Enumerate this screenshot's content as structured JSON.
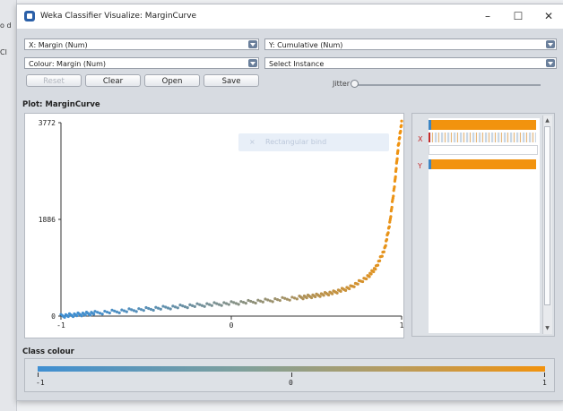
{
  "outer": {
    "labels": [
      "o d",
      "Cl"
    ]
  },
  "window": {
    "title": "Weka Classifier Visualize: MarginCurve",
    "minimize": "–",
    "maximize": "☐",
    "close": "✕"
  },
  "controls": {
    "x_axis": "X: Margin (Num)",
    "y_axis": "Y: Cumulative (Num)",
    "colour": "Colour: Margin (Num)",
    "select_instance": "Select Instance",
    "reset": "Reset",
    "clear": "Clear",
    "open": "Open",
    "save": "Save",
    "jitter": "Jitter"
  },
  "plot": {
    "label": "Plot: MarginCurve",
    "tooltip": "Rectangular bind",
    "tooltip_icon": "×"
  },
  "side": {
    "x_label": "X",
    "y_label": "Y"
  },
  "class_colour": {
    "label": "Class colour",
    "min": "-1",
    "mid": "0",
    "max": "1"
  },
  "colors": {
    "low": "#3f8fd2",
    "high": "#f2930e"
  },
  "chart_data": {
    "type": "scatter",
    "title": "",
    "xlabel": "",
    "ylabel": "",
    "xlim": [
      -1,
      1
    ],
    "ylim": [
      0,
      3772
    ],
    "x_ticks": [
      "-1",
      "0",
      "1"
    ],
    "y_ticks": [
      "0",
      "1886",
      "3772"
    ],
    "curve": [
      [
        -1.0,
        0
      ],
      [
        -0.9,
        30
      ],
      [
        -0.8,
        60
      ],
      [
        -0.6,
        110
      ],
      [
        -0.4,
        160
      ],
      [
        -0.2,
        210
      ],
      [
        0.0,
        250
      ],
      [
        0.2,
        300
      ],
      [
        0.4,
        360
      ],
      [
        0.5,
        400
      ],
      [
        0.6,
        460
      ],
      [
        0.7,
        560
      ],
      [
        0.8,
        760
      ],
      [
        0.85,
        950
      ],
      [
        0.9,
        1300
      ],
      [
        0.93,
        1800
      ],
      [
        0.96,
        2600
      ],
      [
        0.98,
        3300
      ],
      [
        1.0,
        3772
      ]
    ]
  }
}
